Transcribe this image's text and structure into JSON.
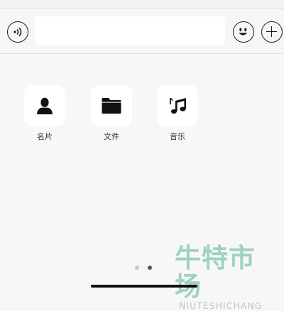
{
  "input_bar": {
    "voice_icon": "voice-waves-icon",
    "message_value": "",
    "emoji_icon": "smiley-face-icon",
    "more_icon": "plus-icon"
  },
  "panel": {
    "items": [
      {
        "label": "名片",
        "icon": "person-icon"
      },
      {
        "label": "文件",
        "icon": "folder-icon"
      },
      {
        "label": "音乐",
        "icon": "music-note-icon"
      }
    ],
    "page_count": 2,
    "current_page": 2
  },
  "watermark": {
    "main": "牛特市场",
    "sub": "NIUTESHICHANG"
  },
  "colors": {
    "background": "#f7f7f7",
    "tile": "#ffffff",
    "icon": "#111111",
    "dot_inactive": "#c8c8c8",
    "dot_active": "#555555",
    "watermark": "#8fcbb8"
  }
}
